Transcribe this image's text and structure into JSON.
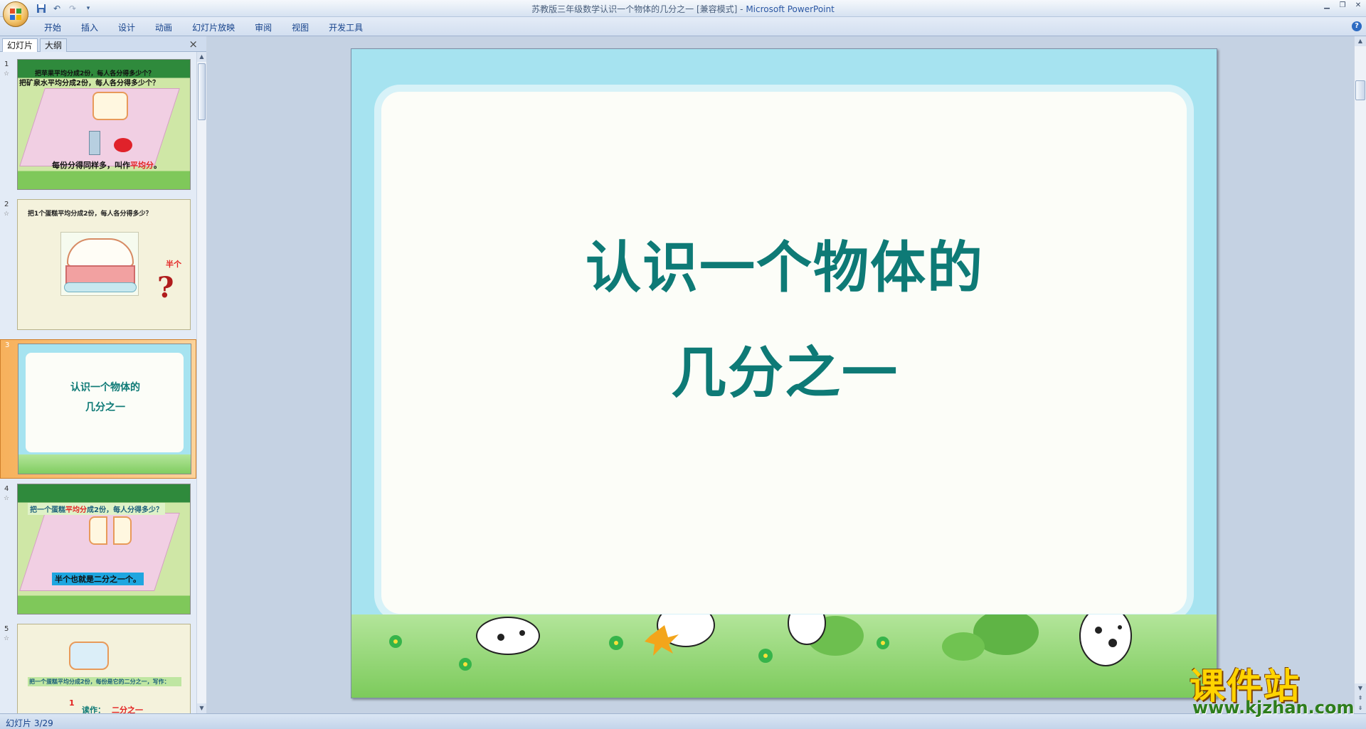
{
  "titlebar": {
    "title": "苏教版三年级数学认识一个物体的几分之一 [兼容模式]",
    "separator": " - ",
    "app": "Microsoft PowerPoint",
    "qat_icons": [
      "save-icon",
      "undo-icon",
      "redo-icon",
      "customize-icon"
    ]
  },
  "ribbon": {
    "tabs": [
      "开始",
      "插入",
      "设计",
      "动画",
      "幻灯片放映",
      "审阅",
      "视图",
      "开发工具"
    ]
  },
  "left_panel": {
    "tab_slides": "幻灯片",
    "tab_outline": "大纲",
    "close": "×"
  },
  "thumbnails": [
    {
      "num": "1",
      "line1": "把苹果平均分成2份，每人各分得多少个？",
      "line2": "把矿泉水平均分成2份，每人各分得多少个？",
      "caption_a": "每份分得同样多，叫作",
      "caption_b": "平均分",
      "caption_c": "。"
    },
    {
      "num": "2",
      "line1": "把1个蛋糕平均分成2份，每人各分得多少？",
      "half": "半个",
      "mark": "?"
    },
    {
      "num": "3",
      "line1": "认识一个物体的",
      "line2": "几分之一"
    },
    {
      "num": "4",
      "line1a": "把一个蛋糕",
      "line1b": "平均分",
      "line1c": "成2份，每人分得多少？",
      "caption": "半个也就是二分之一个。"
    },
    {
      "num": "5",
      "line1": "把一个蛋糕平均分成2份，每份是它的二分之一，写作：",
      "one": "1",
      "read_label": "读作：",
      "read_value": "二分之一"
    }
  ],
  "slide": {
    "title_line1": "认识一个物体的",
    "title_line2": "几分之一"
  },
  "statusbar": {
    "text": "幻灯片 3/29"
  },
  "watermark": {
    "title": "课件站",
    "url": "www.kjzhan.com"
  },
  "colors": {
    "title_teal": "#0e7a76",
    "slide_sky": "#a6e3f0",
    "grass": "#7bca5a",
    "selection_orange": "#f7b15c"
  }
}
